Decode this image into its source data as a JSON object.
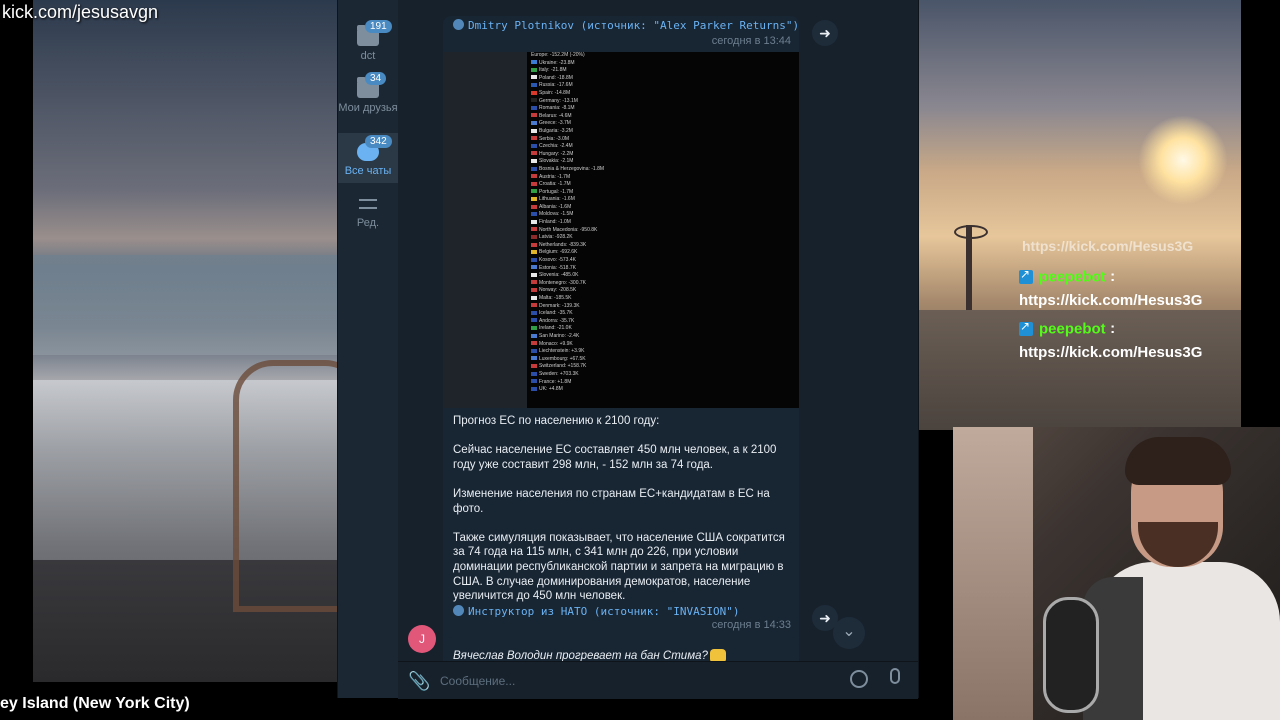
{
  "stream": {
    "top_url": "kick.com/jesusavgn",
    "location_caption": "ey Island (New York City)"
  },
  "chat": {
    "partial_top": "https://kick.com/Hesus3G",
    "messages": [
      {
        "user": "peepebot",
        "colon": ":",
        "text": "https://kick.com/Hesus3G"
      },
      {
        "user": "peepebot",
        "colon": ":",
        "text": "https://kick.com/Hesus3G"
      }
    ]
  },
  "telegram": {
    "folders": [
      {
        "label": "dct",
        "count": "191",
        "icon": "folder-icon",
        "active": false
      },
      {
        "label": "Мои друзья",
        "count": "34",
        "icon": "folder-icon",
        "active": false
      },
      {
        "label": "Все чаты",
        "count": "342",
        "icon": "chats-icon",
        "active": true
      },
      {
        "label": "Ред.",
        "count": "",
        "icon": "edit-folders-icon",
        "active": false
      }
    ],
    "post1": {
      "forwarded": "Dmitry Plotnikov (источник: \"Alex Parker Returns\")",
      "time": "сегодня в 13:44",
      "image_header": "Europe: -152.2M (-20%)",
      "image_rows": [
        {
          "c": "Ukraine: -23.8M",
          "flag": "#3b7bd6"
        },
        {
          "c": "Italy: -21.8M",
          "flag": "#2f9e44"
        },
        {
          "c": "Poland: -18.8M",
          "flag": "#e8e8e8"
        },
        {
          "c": "Russia: -17.6M",
          "flag": "#2a57b0"
        },
        {
          "c": "Spain: -14.8M",
          "flag": "#d8392b"
        },
        {
          "c": "Germany: -13.1M",
          "flag": "#222222"
        },
        {
          "c": "Romania: -8.1M",
          "flag": "#2b4fa8"
        },
        {
          "c": "Belarus: -4.6M",
          "flag": "#c53b3b"
        },
        {
          "c": "Greece: -3.7M",
          "flag": "#4a7ad0"
        },
        {
          "c": "Bulgaria: -3.2M",
          "flag": "#e8e8e8"
        },
        {
          "c": "Serbia: -3.0M",
          "flag": "#c53b3b"
        },
        {
          "c": "Czechia: -2.4M",
          "flag": "#2b4fa8"
        },
        {
          "c": "Hungary: -2.2M",
          "flag": "#c53b3b"
        },
        {
          "c": "Slovakia: -2.1M",
          "flag": "#e8e8e8"
        },
        {
          "c": "Bosnia & Herzegovina: -1.8M",
          "flag": "#2b4fa8"
        },
        {
          "c": "Austria: -1.7M",
          "flag": "#c53b3b"
        },
        {
          "c": "Croatia: -1.7M",
          "flag": "#c53b3b"
        },
        {
          "c": "Portugal: -1.7M",
          "flag": "#2f9e44"
        },
        {
          "c": "Lithuania: -1.6M",
          "flag": "#e0b52a"
        },
        {
          "c": "Albania: -1.6M",
          "flag": "#c53b3b"
        },
        {
          "c": "Moldova: -1.5M",
          "flag": "#2b4fa8"
        },
        {
          "c": "Finland: -1.0M",
          "flag": "#e8e8e8"
        },
        {
          "c": "North Macedonia: -950.8K",
          "flag": "#c53b3b"
        },
        {
          "c": "Latvia: -928.2K",
          "flag": "#8e2a2a"
        },
        {
          "c": "Netherlands: -839.3K",
          "flag": "#c53b3b"
        },
        {
          "c": "Belgium: -692.6K",
          "flag": "#e0b52a"
        },
        {
          "c": "Kosovo: -573.4K",
          "flag": "#2b4fa8"
        },
        {
          "c": "Estonia: -518.7K",
          "flag": "#4a7ad0"
        },
        {
          "c": "Slovenia: -485.0K",
          "flag": "#e8e8e8"
        },
        {
          "c": "Montenegro: -300.7K",
          "flag": "#c53b3b"
        },
        {
          "c": "Norway: -208.5K",
          "flag": "#c53b3b"
        },
        {
          "c": "Malta: -185.5K",
          "flag": "#e8e8e8"
        },
        {
          "c": "Denmark: -139.3K",
          "flag": "#c53b3b"
        },
        {
          "c": "Iceland: -35.7K",
          "flag": "#2b4fa8"
        },
        {
          "c": "Andorra: -35.7K",
          "flag": "#2b4fa8"
        },
        {
          "c": "Ireland: -21.0K",
          "flag": "#2f9e44"
        },
        {
          "c": "San Marino: -2.4K",
          "flag": "#4a7ad0"
        },
        {
          "c": "Monaco: +9.9K",
          "flag": "#c53b3b"
        },
        {
          "c": "Liechtenstein: +3.9K",
          "flag": "#2b4fa8"
        },
        {
          "c": "Luxembourg: +67.5K",
          "flag": "#4a7ad0"
        },
        {
          "c": "Switzerland: +158.7K",
          "flag": "#c53b3b"
        },
        {
          "c": "Sweden: +703.3K",
          "flag": "#2b4fa8"
        },
        {
          "c": "France: +1.8M",
          "flag": "#2b4fa8"
        },
        {
          "c": "UK: +4.8M",
          "flag": "#2b4fa8"
        }
      ],
      "paragraphs": [
        "Прогноз ЕС по населению к 2100 году:",
        "Сейчас население ЕС составляет 450 млн человек, а к 2100 году уже составит 298 млн, - 152 млн за 74 года.",
        "Изменение населения по странам ЕС+кандидатам в ЕС на фото.",
        "Также симуляция показывает, что население США сократится за 74 года на 115 млн, с 341 млн до 226, при условии доминации республиканской партии и запрета на миграцию в США. В случае доминирования демократов, население увеличится до 450 млн человек."
      ],
      "forwarded2": "Инструктор из НАТО (источник: \"INVASION\")",
      "time2": "сегодня в 14:33"
    },
    "last_message": {
      "avatar_letter": "J",
      "text": "Вячеслав Володин прогревает на бан Стима?"
    },
    "composer": {
      "placeholder": "Сообщение..."
    }
  }
}
